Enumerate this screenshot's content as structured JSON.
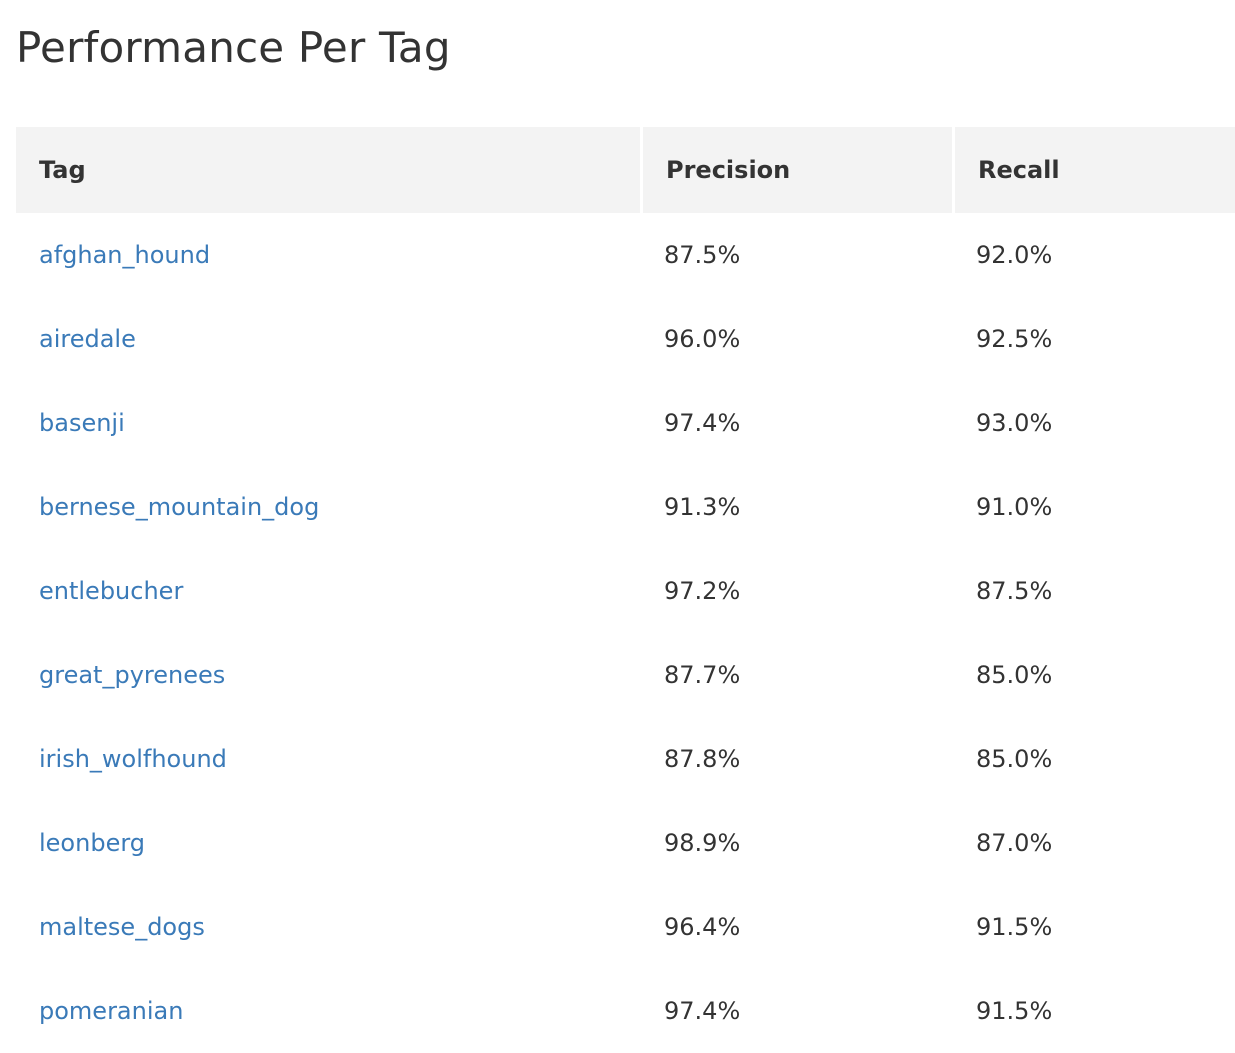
{
  "page": {
    "title": "Performance Per Tag"
  },
  "table": {
    "headers": {
      "tag": "Tag",
      "precision": "Precision",
      "recall": "Recall"
    },
    "rows": [
      {
        "tag": "afghan_hound",
        "precision": "87.5%",
        "recall": "92.0%"
      },
      {
        "tag": "airedale",
        "precision": "96.0%",
        "recall": "92.5%"
      },
      {
        "tag": "basenji",
        "precision": "97.4%",
        "recall": "93.0%"
      },
      {
        "tag": "bernese_mountain_dog",
        "precision": "91.3%",
        "recall": "91.0%"
      },
      {
        "tag": "entlebucher",
        "precision": "97.2%",
        "recall": "87.5%"
      },
      {
        "tag": "great_pyrenees",
        "precision": "87.7%",
        "recall": "85.0%"
      },
      {
        "tag": "irish_wolfhound",
        "precision": "87.8%",
        "recall": "85.0%"
      },
      {
        "tag": "leonberg",
        "precision": "98.9%",
        "recall": "87.0%"
      },
      {
        "tag": "maltese_dogs",
        "precision": "96.4%",
        "recall": "91.5%"
      },
      {
        "tag": "pomeranian",
        "precision": "97.4%",
        "recall": "91.5%"
      }
    ]
  },
  "colors": {
    "link": "#3a7ab8",
    "header_bg": "#f3f3f3",
    "text": "#333333"
  }
}
